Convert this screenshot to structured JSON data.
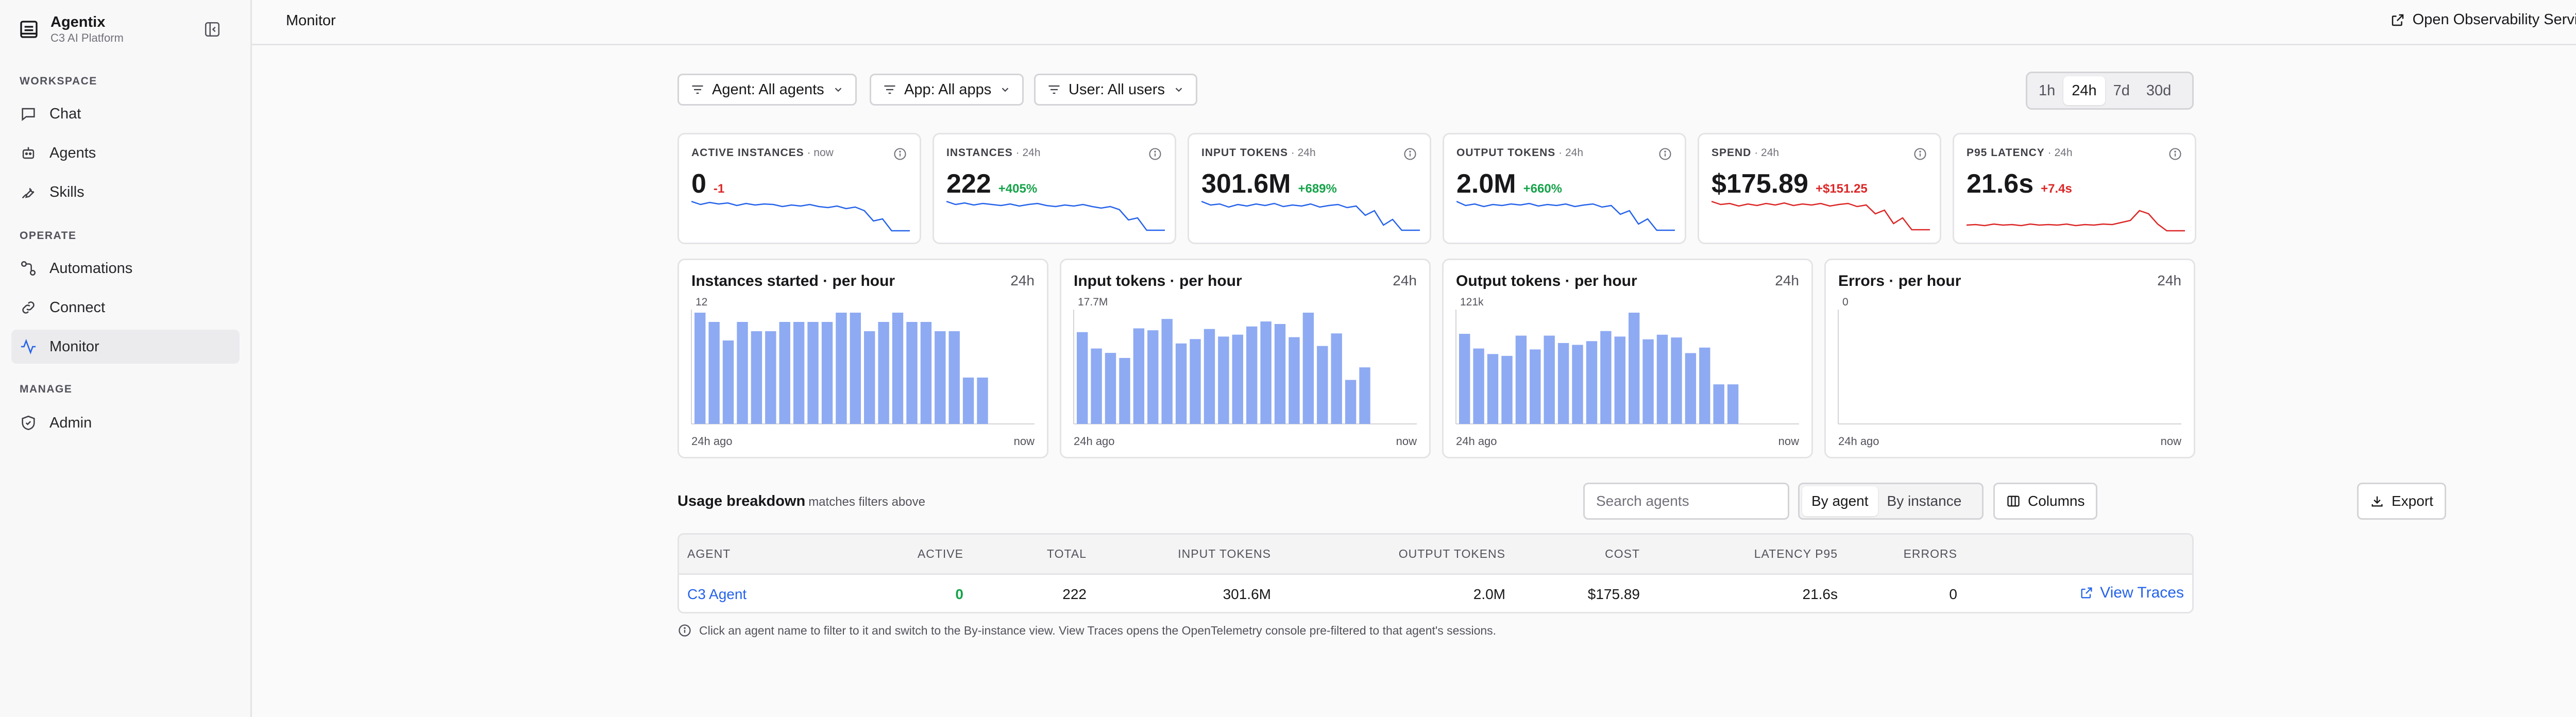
{
  "sidebar": {
    "brand": {
      "name": "Agentix",
      "subtitle": "C3 AI Platform"
    },
    "sections": [
      {
        "label": "WORKSPACE",
        "items": [
          {
            "label": "Chat"
          },
          {
            "label": "Agents"
          },
          {
            "label": "Skills"
          }
        ]
      },
      {
        "label": "OPERATE",
        "items": [
          {
            "label": "Automations"
          },
          {
            "label": "Connect"
          },
          {
            "label": "Monitor",
            "active": true
          }
        ]
      },
      {
        "label": "MANAGE",
        "items": [
          {
            "label": "Admin"
          }
        ]
      }
    ]
  },
  "header": {
    "title": "Monitor",
    "observability_link": "Open Observability Service"
  },
  "filters": {
    "agent": "Agent: All agents",
    "app": "App: All apps",
    "user": "User: All users"
  },
  "time_range": {
    "options": [
      "1h",
      "24h",
      "7d",
      "30d"
    ],
    "selected": "24h"
  },
  "kpis": [
    {
      "label": "ACTIVE INSTANCES",
      "period": " · now",
      "value": "0",
      "delta": "-1",
      "delta_color": "#dc2626",
      "spark_color": "#2563eb",
      "spark": [
        6,
        5.4,
        5.8,
        5.5,
        5.7,
        5.2,
        5.6,
        5.3,
        5.5,
        5.4,
        5,
        5.3,
        5.1,
        5.4,
        5,
        4.8,
        5.1,
        4.6,
        4.9,
        4.2,
        2.2,
        2.6,
        0.3,
        0.3,
        0.3
      ]
    },
    {
      "label": "INSTANCES",
      "period": " · 24h",
      "value": "222",
      "delta": "+405%",
      "delta_color": "#16a34a",
      "spark_color": "#2563eb",
      "spark": [
        6,
        5.4,
        5.7,
        5.3,
        5.6,
        5.4,
        5.2,
        5.5,
        5.1,
        5.4,
        5.6,
        5.2,
        5,
        5.3,
        5.1,
        5.4,
        5,
        4.7,
        5,
        4.4,
        2.4,
        2.8,
        0.4,
        0.4,
        0.4
      ]
    },
    {
      "label": "INPUT TOKENS",
      "period": " · 24h",
      "value": "301.6M",
      "delta": "+689%",
      "delta_color": "#16a34a",
      "spark_color": "#2563eb",
      "spark": [
        6,
        5.3,
        5.5,
        4.9,
        5.4,
        5.1,
        5.5,
        5.2,
        5.6,
        5,
        5.3,
        5.1,
        5.5,
        4.9,
        5.2,
        5.4,
        4.8,
        5.1,
        3.3,
        4.2,
        1.4,
        2.5,
        0.4,
        0.4,
        0.4
      ]
    },
    {
      "label": "OUTPUT TOKENS",
      "period": " · 24h",
      "value": "2.0M",
      "delta": "+660%",
      "delta_color": "#16a34a",
      "spark_color": "#2563eb",
      "spark": [
        6,
        5.2,
        5.5,
        5,
        5.4,
        5.2,
        5.5,
        5.3,
        5.6,
        5.1,
        5.4,
        5.2,
        5.5,
        5,
        5.3,
        5.5,
        4.9,
        5.2,
        3.5,
        4.2,
        1.6,
        2.6,
        0.4,
        0.4,
        0.4
      ]
    },
    {
      "label": "SPEND",
      "period": " · 24h",
      "value": "$175.89",
      "delta": "+$151.25",
      "delta_color": "#dc2626",
      "spark_color": "#dc2626",
      "spark": [
        6,
        5.4,
        5.6,
        5.1,
        5.5,
        5.2,
        5.6,
        5.3,
        5.7,
        5.2,
        5.5,
        5.3,
        5.6,
        5.1,
        5.4,
        5.6,
        5,
        5.3,
        3.6,
        4.3,
        1.7,
        2.8,
        0.5,
        0.5,
        0.5
      ]
    },
    {
      "label": "P95 LATENCY",
      "period": " · 24h",
      "value": "21.6s",
      "delta": "+7.4s",
      "delta_color": "#dc2626",
      "spark_color": "#dc2626",
      "spark": [
        1.4,
        1.5,
        1.3,
        1.6,
        1.4,
        1.5,
        1.3,
        1.6,
        1.4,
        1.5,
        1.4,
        1.6,
        1.3,
        1.5,
        1.4,
        1.6,
        1.5,
        1.9,
        2.3,
        4.2,
        3.6,
        1.6,
        0.3,
        0.3,
        0.3
      ]
    }
  ],
  "charts": [
    {
      "title": "Instances started · per hour",
      "range": "24h",
      "ymax_label": "12",
      "from_label": "24h ago",
      "to_label": "now",
      "color": "#8eaaf2",
      "bars": [
        12,
        11,
        9,
        11,
        10,
        10,
        11,
        11,
        11,
        11,
        12,
        12,
        10,
        11,
        12,
        11,
        11,
        10,
        10,
        5,
        5,
        0,
        0
      ]
    },
    {
      "title": "Input tokens · per hour",
      "range": "24h",
      "ymax_label": "17.7M",
      "from_label": "24h ago",
      "to_label": "now",
      "color": "#8eaaf2",
      "bars": [
        14.6,
        12,
        11.3,
        10.5,
        15.2,
        14.9,
        16.7,
        12.8,
        13.5,
        15.1,
        13.9,
        14.2,
        15.5,
        16.3,
        15.9,
        13.8,
        17.7,
        12.4,
        14.4,
        7,
        9,
        0,
        0
      ]
    },
    {
      "title": "Output tokens · per hour",
      "range": "24h",
      "ymax_label": "121k",
      "from_label": "24h ago",
      "to_label": "now",
      "color": "#8eaaf2",
      "bars": [
        98,
        82,
        76,
        74,
        96,
        81,
        96,
        88,
        86,
        90,
        101,
        95,
        121,
        92,
        97,
        94,
        77,
        83,
        43,
        43,
        0,
        0,
        0
      ]
    },
    {
      "title": "Errors · per hour",
      "range": "24h",
      "ymax_label": "0",
      "from_label": "24h ago",
      "to_label": "now",
      "color": "#8eaaf2",
      "bars": []
    }
  ],
  "usage": {
    "title": "Usage breakdown",
    "subtitle": "matches filters above",
    "search_placeholder": "Search agents",
    "view_toggle": {
      "options": [
        "By agent",
        "By instance"
      ],
      "selected": "By agent"
    },
    "columns_button": "Columns",
    "export_button": "Export",
    "headers": [
      "AGENT",
      "ACTIVE",
      "TOTAL",
      "INPUT TOKENS",
      "OUTPUT TOKENS",
      "COST",
      "LATENCY P95",
      "ERRORS"
    ],
    "rows": [
      {
        "agent": "C3 Agent",
        "active": "0",
        "total": "222",
        "input_tokens": "301.6M",
        "output_tokens": "2.0M",
        "cost": "$175.89",
        "latency_p95": "21.6s",
        "errors": "0",
        "action": "View Traces"
      }
    ],
    "hint": "Click an agent name to filter to it and switch to the By-instance view. View Traces opens the OpenTelemetry console pre-filtered to that agent's sessions."
  },
  "colors": {
    "accent": "#2563eb",
    "positive": "#16a34a",
    "negative": "#dc2626",
    "bar": "#8eaaf2"
  }
}
